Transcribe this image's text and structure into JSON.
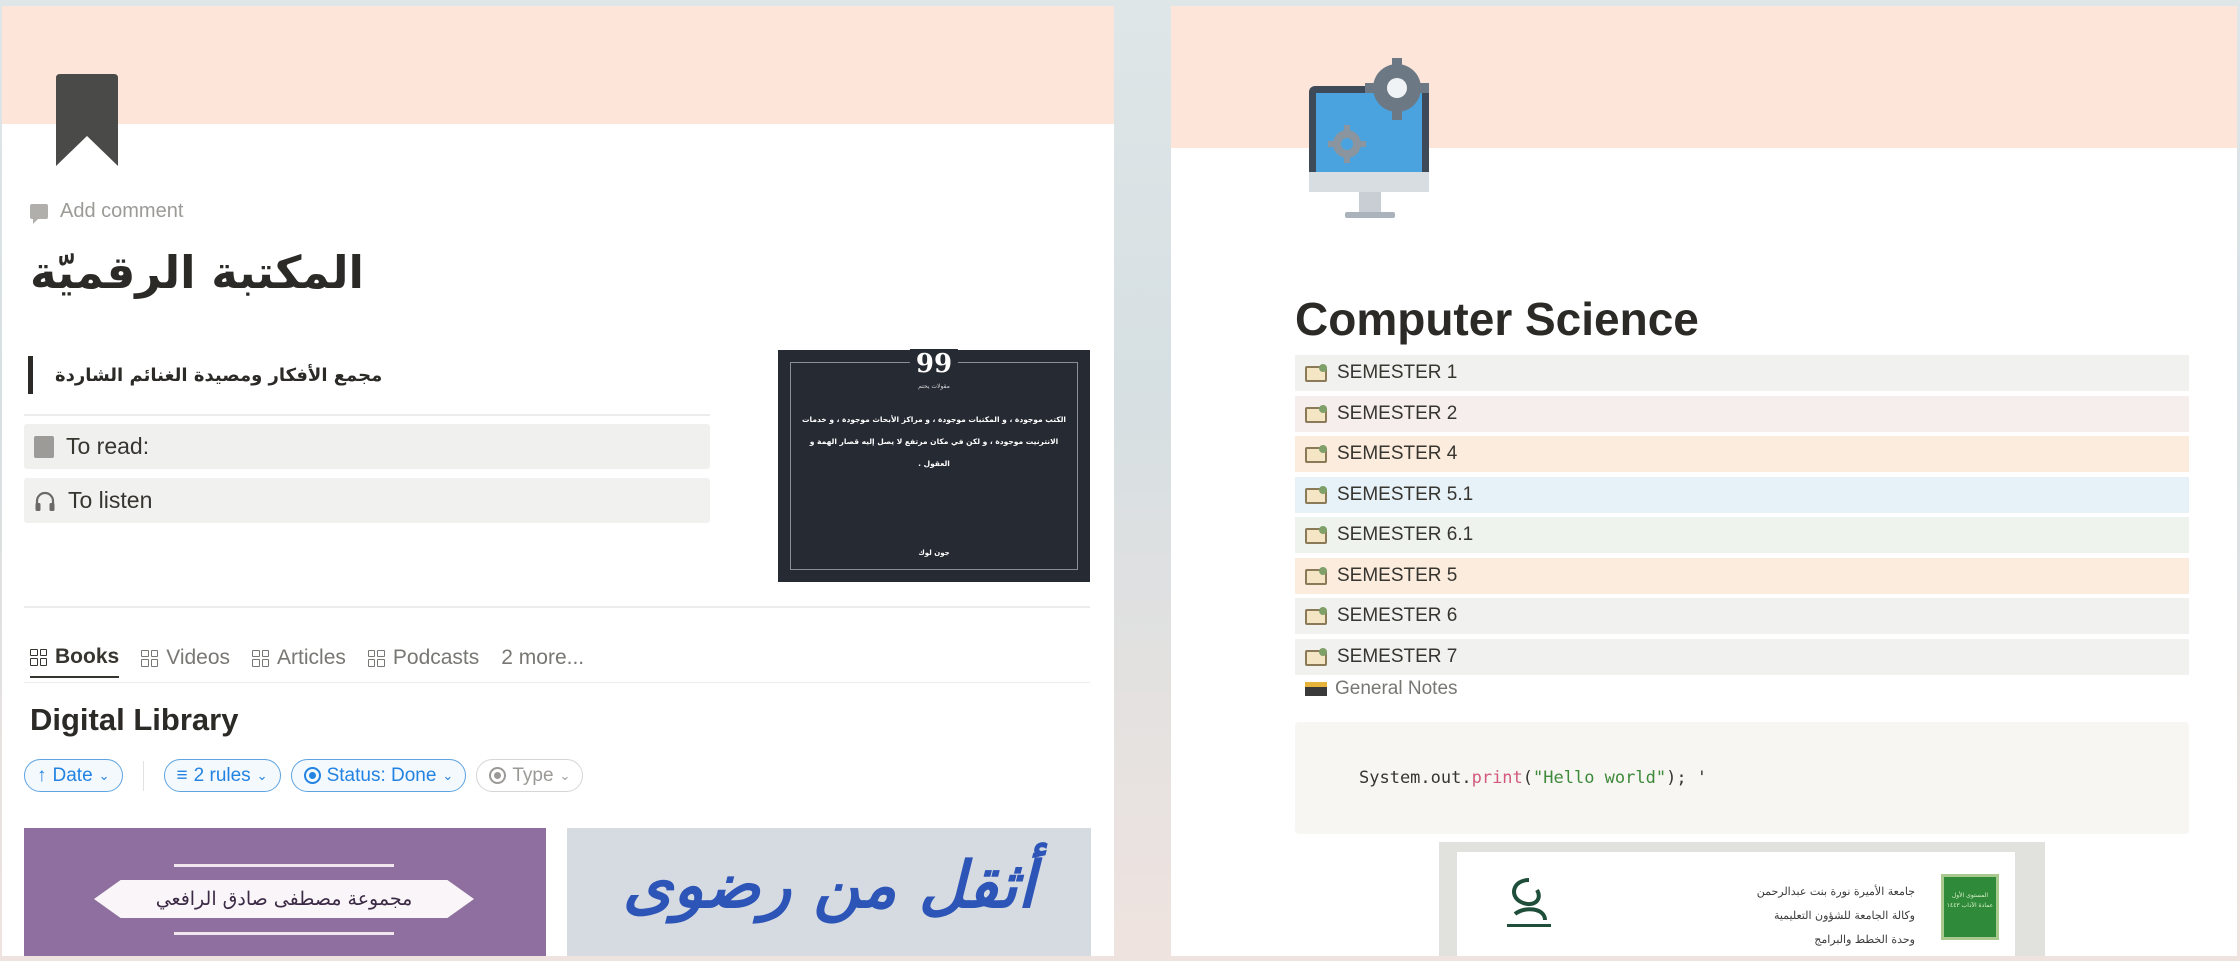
{
  "left_page": {
    "add_comment": "Add comment",
    "title": "المكتبة الرقميّة",
    "quote": "مجمع الأفكار ومصيدة الغنائم الشاردة",
    "links": [
      {
        "label": "To read:",
        "icon": "book-icon"
      },
      {
        "label": "To listen",
        "icon": "headphones-icon"
      }
    ],
    "quote_card": {
      "mark": "99",
      "heading": "مقولات يحتم",
      "text": "الكتب موجودة ، و المكتبات موجودة ، و مراكز الأبحاث موجودة ، و خدمات الانترنيت موجودة ، و لكن في مكان مرتفع لا يصل إليه قصار الهمة و العقول .",
      "author": "جون لوك"
    },
    "tabs": [
      "Books",
      "Videos",
      "Articles",
      "Podcasts"
    ],
    "tabs_more": "2 more...",
    "db_title": "Digital Library",
    "filters": {
      "sort": "Date",
      "rules": "2 rules",
      "status": "Status: Done",
      "type": "Type"
    },
    "covers": [
      {
        "title": "مجموعة مصطفى صادق الرافعي",
        "color": "#8e6f9f"
      },
      {
        "title": "أثقل من رضوى",
        "color": "#d6dbe2"
      }
    ]
  },
  "right_page": {
    "title": "Computer Science",
    "semesters": [
      {
        "label": "SEMESTER 1",
        "bg": "#f1f1ef"
      },
      {
        "label": "SEMESTER 2",
        "bg": "#f6eeec"
      },
      {
        "label": "SEMESTER 4",
        "bg": "#fbecdd"
      },
      {
        "label": "SEMESTER 5.1",
        "bg": "#e7f1f8"
      },
      {
        "label": "SEMESTER 6.1",
        "bg": "#eef3ed"
      },
      {
        "label": "SEMESTER 5",
        "bg": "#fbecdd"
      },
      {
        "label": "SEMESTER 6",
        "bg": "#f1f1ef"
      },
      {
        "label": "SEMESTER 7",
        "bg": "#f1f1ef"
      }
    ],
    "general_notes": "General Notes",
    "code": {
      "prefix": "System.out.",
      "keyword": "print",
      "open": "(",
      "string": "\"Hello world\"",
      "suffix": "); '"
    },
    "doc_preview": {
      "text_lines": [
        "جامعة الأميرة نورة بنت عبدالرحمن",
        "وكالة الجامعة للشؤون التعليمية",
        "وحدة الخطط والبرامج"
      ],
      "badge": "المستوى الأول عمادة الآداب ١٤٤٣"
    }
  }
}
